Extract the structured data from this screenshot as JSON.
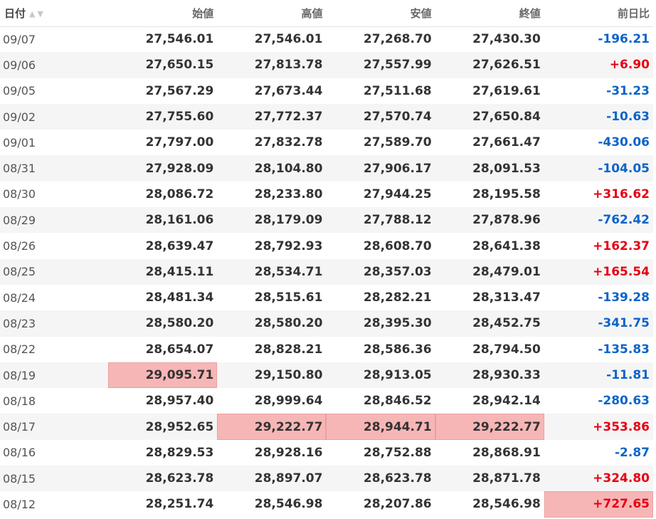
{
  "headers": {
    "date": "日付",
    "open": "始値",
    "high": "高値",
    "low": "安値",
    "close": "終値",
    "change": "前日比"
  },
  "sort": {
    "up_icon": "▲",
    "down_icon": "▼"
  },
  "colors": {
    "positive": "#e60012",
    "negative": "#0d63c9",
    "highlight": "#f7b6b6"
  },
  "rows": [
    {
      "date": "09/07",
      "open": "27,546.01",
      "high": "27,546.01",
      "low": "27,268.70",
      "close": "27,430.30",
      "change": "-196.21"
    },
    {
      "date": "09/06",
      "open": "27,650.15",
      "high": "27,813.78",
      "low": "27,557.99",
      "close": "27,626.51",
      "change": "+6.90"
    },
    {
      "date": "09/05",
      "open": "27,567.29",
      "high": "27,673.44",
      "low": "27,511.68",
      "close": "27,619.61",
      "change": "-31.23"
    },
    {
      "date": "09/02",
      "open": "27,755.60",
      "high": "27,772.37",
      "low": "27,570.74",
      "close": "27,650.84",
      "change": "-10.63"
    },
    {
      "date": "09/01",
      "open": "27,797.00",
      "high": "27,832.78",
      "low": "27,589.70",
      "close": "27,661.47",
      "change": "-430.06"
    },
    {
      "date": "08/31",
      "open": "27,928.09",
      "high": "28,104.80",
      "low": "27,906.17",
      "close": "28,091.53",
      "change": "-104.05"
    },
    {
      "date": "08/30",
      "open": "28,086.72",
      "high": "28,233.80",
      "low": "27,944.25",
      "close": "28,195.58",
      "change": "+316.62"
    },
    {
      "date": "08/29",
      "open": "28,161.06",
      "high": "28,179.09",
      "low": "27,788.12",
      "close": "27,878.96",
      "change": "-762.42"
    },
    {
      "date": "08/26",
      "open": "28,639.47",
      "high": "28,792.93",
      "low": "28,608.70",
      "close": "28,641.38",
      "change": "+162.37"
    },
    {
      "date": "08/25",
      "open": "28,415.11",
      "high": "28,534.71",
      "low": "28,357.03",
      "close": "28,479.01",
      "change": "+165.54"
    },
    {
      "date": "08/24",
      "open": "28,481.34",
      "high": "28,515.61",
      "low": "28,282.21",
      "close": "28,313.47",
      "change": "-139.28"
    },
    {
      "date": "08/23",
      "open": "28,580.20",
      "high": "28,580.20",
      "low": "28,395.30",
      "close": "28,452.75",
      "change": "-341.75"
    },
    {
      "date": "08/22",
      "open": "28,654.07",
      "high": "28,828.21",
      "low": "28,586.36",
      "close": "28,794.50",
      "change": "-135.83"
    },
    {
      "date": "08/19",
      "open": "29,095.71",
      "high": "29,150.80",
      "low": "28,913.05",
      "close": "28,930.33",
      "change": "-11.81",
      "highlight": [
        "open"
      ]
    },
    {
      "date": "08/18",
      "open": "28,957.40",
      "high": "28,999.64",
      "low": "28,846.52",
      "close": "28,942.14",
      "change": "-280.63"
    },
    {
      "date": "08/17",
      "open": "28,952.65",
      "high": "29,222.77",
      "low": "28,944.71",
      "close": "29,222.77",
      "change": "+353.86",
      "highlight": [
        "high",
        "low",
        "close"
      ]
    },
    {
      "date": "08/16",
      "open": "28,829.53",
      "high": "28,928.16",
      "low": "28,752.88",
      "close": "28,868.91",
      "change": "-2.87"
    },
    {
      "date": "08/15",
      "open": "28,623.78",
      "high": "28,897.07",
      "low": "28,623.78",
      "close": "28,871.78",
      "change": "+324.80"
    },
    {
      "date": "08/12",
      "open": "28,251.74",
      "high": "28,546.98",
      "low": "28,207.86",
      "close": "28,546.98",
      "change": "+727.65",
      "highlight": [
        "change"
      ]
    }
  ]
}
